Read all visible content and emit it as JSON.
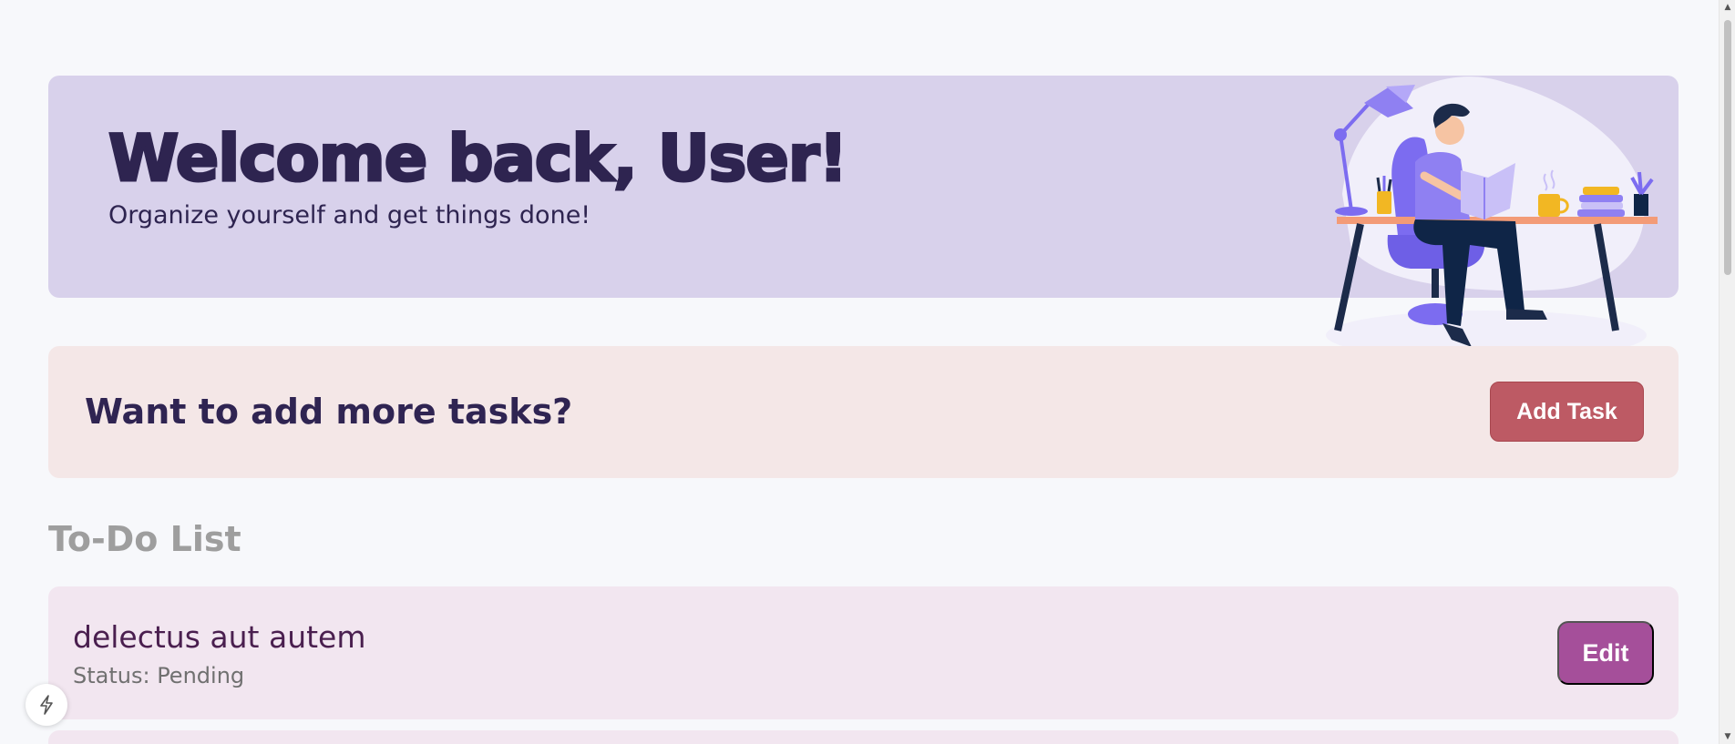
{
  "welcome": {
    "title": "Welcome back, User!",
    "subtitle": "Organize yourself and get things done!"
  },
  "add_panel": {
    "prompt": "Want to add more tasks?",
    "button_label": "Add Task"
  },
  "todo": {
    "heading": "To-Do List",
    "tasks": [
      {
        "title": "delectus aut autem",
        "status": "Status: Pending",
        "edit_label": "Edit"
      }
    ]
  },
  "colors": {
    "welcome_bg": "#d8d1eb",
    "add_panel_bg": "#f4e7e7",
    "add_button": "#bd5a64",
    "task_bg": "#f2e6f0",
    "edit_button": "#a54f9a"
  },
  "icons": {
    "floating": "lightning-icon",
    "scroll_up": "arrow-up-icon",
    "scroll_down": "arrow-down-icon"
  }
}
